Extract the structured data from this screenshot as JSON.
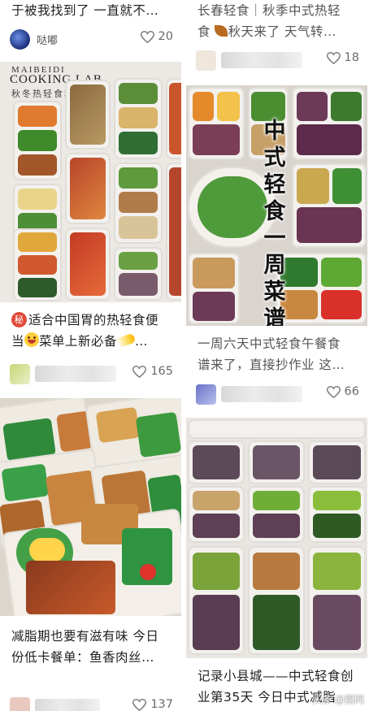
{
  "cards": {
    "left_top": {
      "title_line": "于被我找到了 一直就不…",
      "author": "哒嘟",
      "likes": "20"
    },
    "left_middle": {
      "image_brand_line1": "MAIBEIDI",
      "image_brand_line2": "COOKING LAB",
      "image_subtitle": "秋冬热轻食料理",
      "title_badge": "秘",
      "title_line1": "适合中国胃的热轻食便",
      "title_line2_a": "当",
      "title_line2_b": "菜单上新必备",
      "title_line2_c": "…",
      "likes": "165"
    },
    "left_bottom": {
      "title_line1": "减脂期也要有滋有味 今日",
      "title_line2": "份低卡餐单：鱼香肉丝…",
      "likes": "137"
    },
    "right_top": {
      "title_line1": "长春轻食｜秋季中式热轻",
      "title_line2_a": "食",
      "title_line2_b": "秋天来了 天气转…",
      "likes": "18"
    },
    "right_middle": {
      "image_overlay": "中式轻食一周菜谱",
      "title_line1": "一周六天中式轻食午餐食",
      "title_line2": "谱来了，直接抄作业 这…",
      "likes": "66"
    },
    "right_bottom": {
      "title_line1": "记录小县城——中式轻食创",
      "title_line2": "业第35天 今日中式减脂",
      "watermark": "头条 @丽同"
    }
  },
  "icons": {
    "like": "heart-outline-icon",
    "avatar": "user-avatar-icon"
  },
  "colors": {
    "accent": "#e04a3a",
    "text": "#1f1f1f",
    "muted": "#6b6b6b"
  }
}
